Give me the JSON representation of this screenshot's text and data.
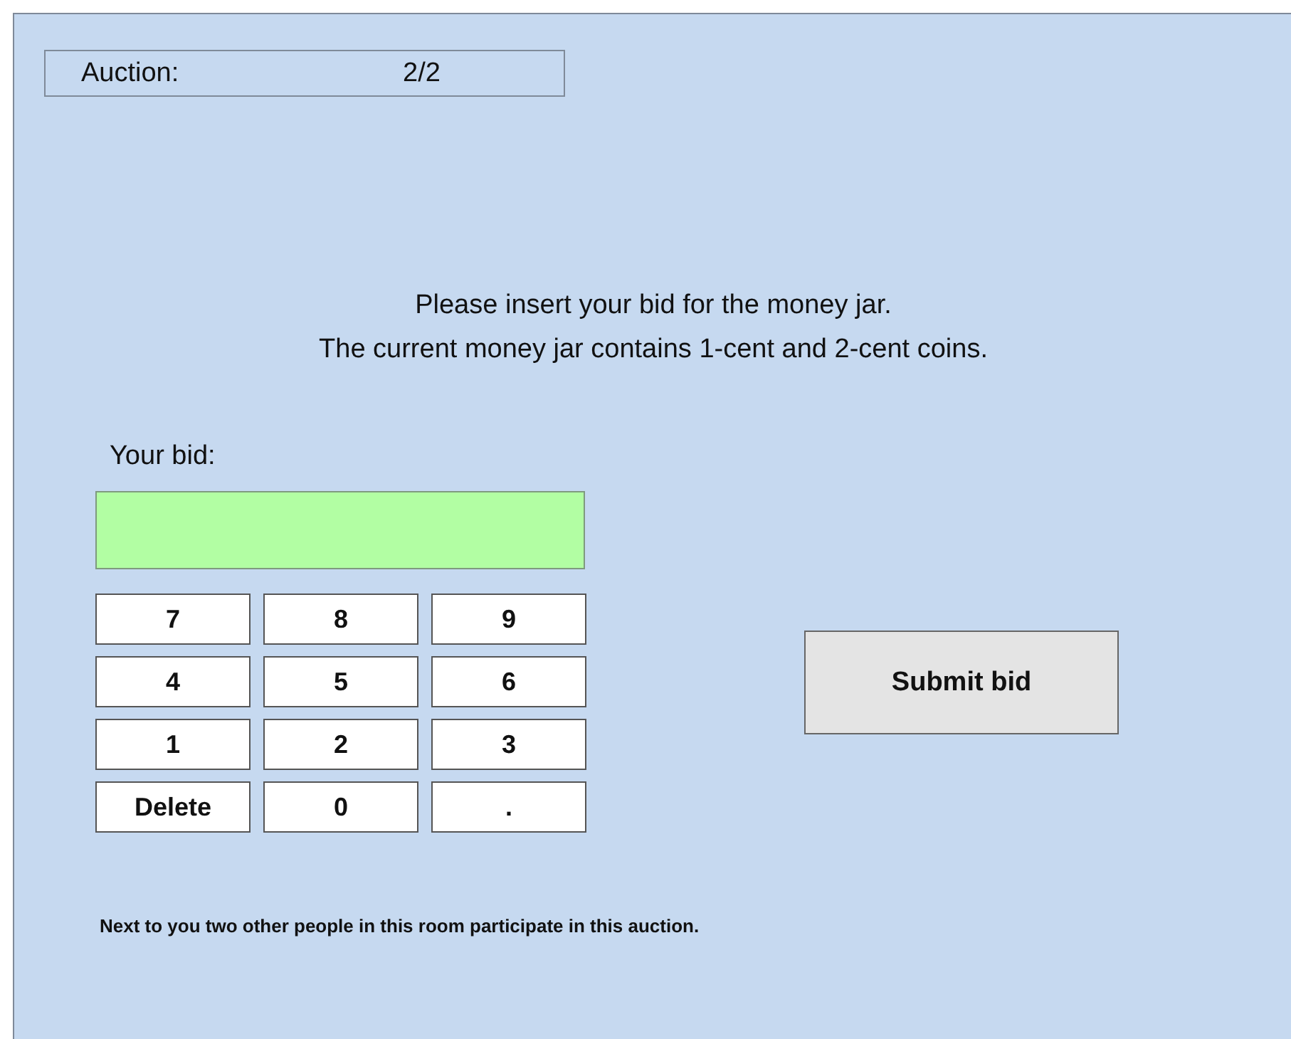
{
  "auction": {
    "label": "Auction:",
    "value": "2/2"
  },
  "instructions": [
    "Please insert your bid for the money jar.",
    "The current money jar contains 1-cent and 2-cent coins."
  ],
  "bid": {
    "label": "Your bid:"
  },
  "keypad": [
    [
      "7",
      "8",
      "9"
    ],
    [
      "4",
      "5",
      "6"
    ],
    [
      "1",
      "2",
      "3"
    ],
    [
      "Delete",
      "0",
      "."
    ]
  ],
  "submit": "Submit bid",
  "footer": "Next to you two other people in this room participate in this auction."
}
